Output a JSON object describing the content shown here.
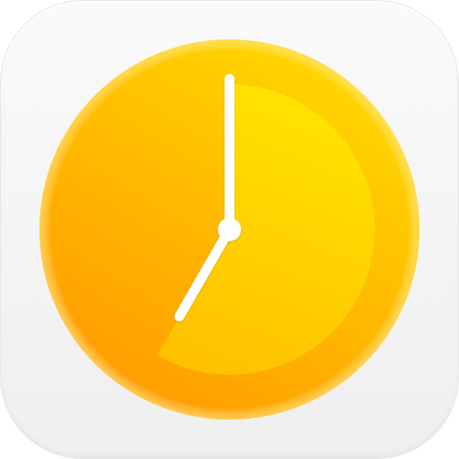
{
  "app_icon": {
    "icon_name": "clock-timer-icon",
    "displayed_time": {
      "hour": 7,
      "minute": 0
    },
    "elapsed_sector_fraction": 0.583,
    "colors": {
      "tile": "#f4f4f4",
      "dial_outer": "#ffc107",
      "dial_inner_light": "#ffd600",
      "dial_inner_dark": "#ff9800",
      "sector_light": "#ffe600",
      "sector_dark": "#ffc400",
      "hands": "#ffffff"
    }
  }
}
